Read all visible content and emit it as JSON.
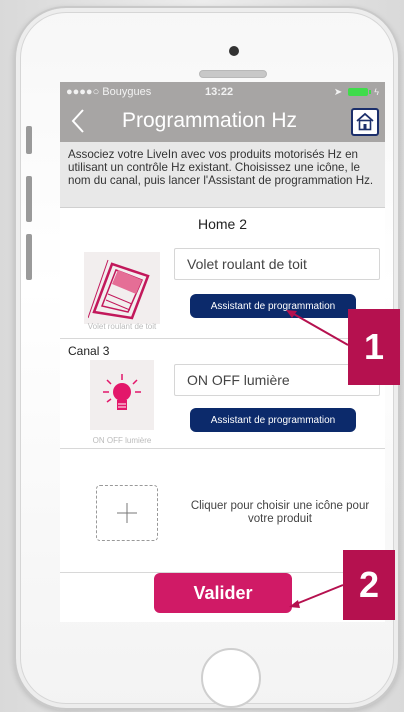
{
  "status_bar": {
    "carrier": "●●●●○ Bouygues",
    "time": "13:22"
  },
  "nav": {
    "back_label": "<",
    "title": "Programmation Hz",
    "home_icon": "home-icon"
  },
  "intro_text": "Associez votre LiveIn avec vos produits motorisés Hz en utilisant un contrôle Hz existant. Choisissez une icône, le nom du canal, puis lancer l'Assistant de programmation Hz.",
  "section_title": "Home 2",
  "channels": [
    {
      "label": "",
      "name": "Volet roulant de toit",
      "icon": "roof-shutter-icon",
      "caption": "Volet roulant de toit",
      "button": "Assistant de programmation"
    },
    {
      "label": "Canal 3",
      "name": "ON OFF lumière",
      "icon": "light-bulb-icon",
      "caption": "ON OFF lumière",
      "button": "Assistant de programmation"
    }
  ],
  "add_product": {
    "icon": "plus-icon",
    "text": "Cliquer pour choisir une icône pour votre produit"
  },
  "validate_button": "Valider",
  "callouts": [
    "1",
    "2"
  ],
  "colors": {
    "nav_bar": "#a7a5a4",
    "primary_button": "#0c2a6b",
    "validate_button": "#d01a66",
    "callout": "#b5114f"
  }
}
